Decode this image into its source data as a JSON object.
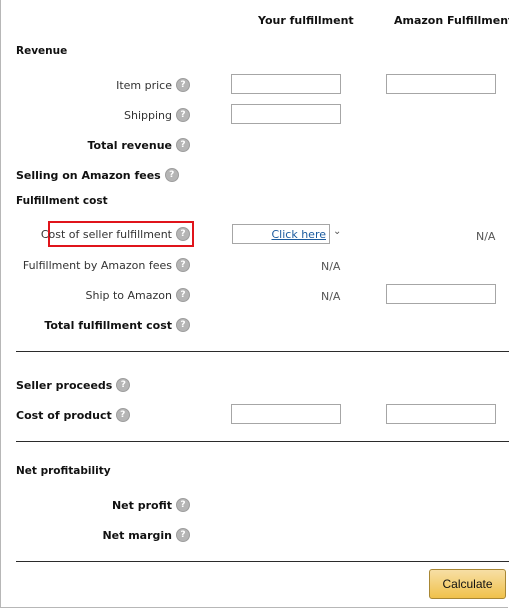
{
  "columns": {
    "your_fulfillment": "Your fulfillment",
    "amazon_fulfillment": "Amazon Fulfillment"
  },
  "revenue": {
    "heading": "Revenue",
    "item_price_label": "Item price",
    "shipping_label": "Shipping",
    "total_revenue_label": "Total revenue"
  },
  "selling_fees": {
    "label": "Selling on Amazon fees"
  },
  "fulfillment_cost": {
    "heading": "Fulfillment cost",
    "cost_of_seller_fulfillment_label": "Cost of seller fulfillment",
    "click_here": "Click here",
    "cost_of_seller_fulfillment_amazon": "N/A",
    "fba_fees_label": "Fulfillment by Amazon fees",
    "fba_fees_your": "N/A",
    "ship_to_amazon_label": "Ship to Amazon",
    "ship_to_amazon_your": "N/A",
    "total_fulfillment_cost_label": "Total fulfillment cost"
  },
  "seller_proceeds": {
    "label": "Seller proceeds"
  },
  "cost_of_product": {
    "label": "Cost of product"
  },
  "net_profitability": {
    "heading": "Net profitability",
    "net_profit_label": "Net profit",
    "net_margin_label": "Net margin"
  },
  "actions": {
    "calculate_label": "Calculate"
  },
  "icons": {
    "help": "help-question-icon",
    "dropdown": "chevron-down-icon"
  },
  "colors": {
    "highlight": "#e0141b",
    "button": "#f0c14b",
    "link": "#1a5a9e"
  }
}
